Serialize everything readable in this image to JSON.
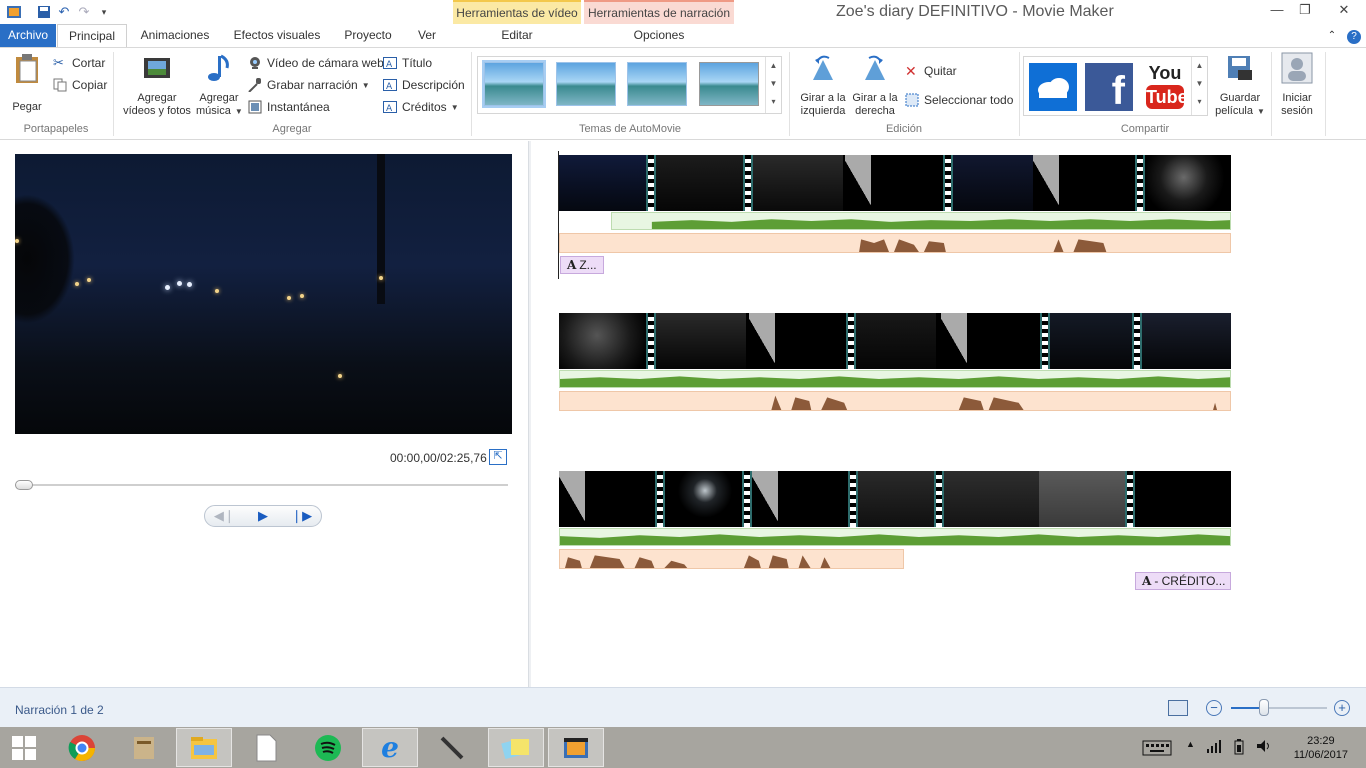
{
  "window": {
    "title": "Zoe's diary DEFINITIVO - Movie Maker",
    "context_tabs": [
      "Herramientas de vídeo",
      "Herramientas de narración"
    ],
    "context_subtabs": [
      "Editar",
      "Opciones"
    ]
  },
  "tabs": [
    "Archivo",
    "Principal",
    "Animaciones",
    "Efectos visuales",
    "Proyecto",
    "Ver"
  ],
  "ribbon": {
    "clipboard": {
      "label": "Portapapeles",
      "paste": "Pegar",
      "cut": "Cortar",
      "copy": "Copiar"
    },
    "add": {
      "label": "Agregar",
      "add_videos": "Agregar\nvídeos y fotos",
      "add_videos_l1": "Agregar",
      "add_videos_l2": "vídeos y fotos",
      "add_music_l1": "Agregar",
      "add_music_l2": "música",
      "webcam": "Vídeo de cámara web",
      "narration": "Grabar narración",
      "snapshot": "Instantánea",
      "title": "Título",
      "caption": "Descripción",
      "credits": "Créditos"
    },
    "automovie": {
      "label": "Temas de AutoMovie"
    },
    "editing": {
      "label": "Edición",
      "rotate_left_l1": "Girar a la",
      "rotate_left_l2": "izquierda",
      "rotate_right_l1": "Girar a la",
      "rotate_right_l2": "derecha",
      "remove": "Quitar",
      "select_all": "Seleccionar todo"
    },
    "share": {
      "label": "Compartir",
      "save_l1": "Guardar",
      "save_l2": "película",
      "signin_l1": "Iniciar",
      "signin_l2": "sesión",
      "youtube_l1": "You",
      "youtube_l2": "Tube",
      "facebook": "f"
    }
  },
  "preview": {
    "timecode": "00:00,00/02:25,76",
    "seek_fraction": 0.0
  },
  "storyboard": {
    "caption_top": "Z...",
    "caption_bottom": "- CRÉDITO...",
    "caption_glyph": "A"
  },
  "status": {
    "text": "Narración 1 de 2",
    "zoom_fraction": 0.34
  },
  "taskbar": {
    "time": "23:29",
    "date": "11/06/2017",
    "apps": [
      "windows-start",
      "chrome",
      "unknown-app",
      "file-explorer",
      "document",
      "spotify",
      "internet-explorer",
      "pen-tool",
      "sticky-notes",
      "movie-maker"
    ]
  },
  "colors": {
    "accent": "#2a6fc6",
    "video_tools": "#fbe9a4",
    "narration_tools": "#fadad3",
    "audio_track": "#6aa83a",
    "narration_track": "#fde3cf"
  }
}
